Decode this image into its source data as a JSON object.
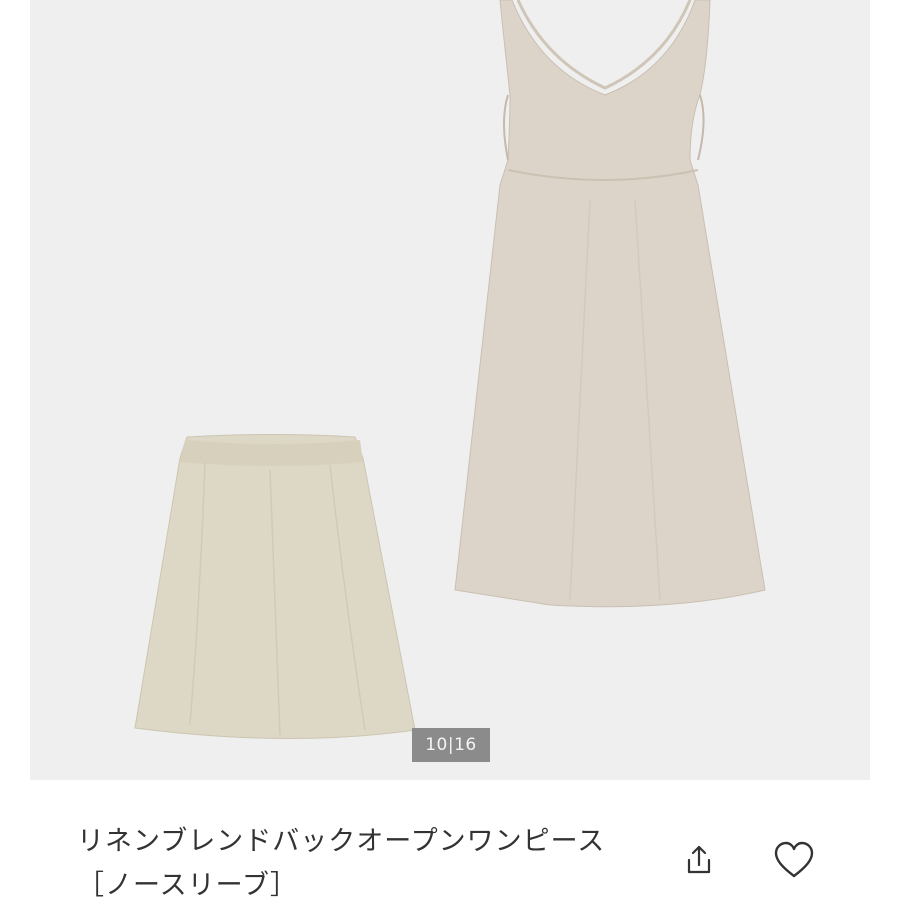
{
  "gallery": {
    "counter_current": "10",
    "counter_separator": "|",
    "counter_total": "16",
    "background_color": "#efefef"
  },
  "product": {
    "title": "リネンブレンドバックオープンワンピース［ノースリーブ］"
  },
  "actions": {
    "share_icon": "share-icon",
    "favorite_icon": "heart-icon"
  }
}
